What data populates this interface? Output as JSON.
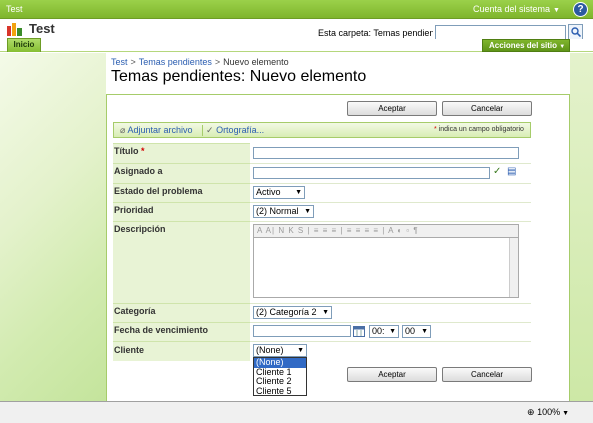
{
  "topbar": {
    "title": "Test",
    "account": "Cuenta del sistema",
    "help_icon": "?"
  },
  "header": {
    "site_title": "Test",
    "search_scope": "Esta carpeta: Temas pendienti",
    "search_value": "",
    "home_tab": "Inicio",
    "site_actions": "Acciones del sitio"
  },
  "breadcrumb": {
    "items": [
      "Test",
      "Temas pendientes",
      "Nuevo elemento"
    ],
    "separator": ">"
  },
  "page_title": "Temas pendientes: Nuevo elemento",
  "buttons": {
    "ok": "Aceptar",
    "cancel": "Cancelar"
  },
  "toolbar": {
    "attach": "Adjuntar archivo",
    "spelling": "Ortografía...",
    "required_marker": "*",
    "required_note": "indica un campo obligatorio"
  },
  "form": {
    "title_label": "Título",
    "title_required": "*",
    "assigned_label": "Asignado a",
    "status_label": "Estado del problema",
    "status_value": "Activo",
    "priority_label": "Prioridad",
    "priority_value": "(2) Normal",
    "description_label": "Descripción",
    "category_label": "Categoría",
    "category_value": "(2) Categoría 2",
    "due_label": "Fecha de vencimiento",
    "due_hour": "00:",
    "due_minute": "00",
    "client_label": "Cliente",
    "client_value": "(None)",
    "client_options": [
      "(None)",
      "Cliente 1",
      "Cliente 2",
      "Cliente 5"
    ]
  },
  "rte_toolbar": "A A| N K S | ≡ ≡ ≡ | ≡ ≡ ≡ ≡ | A ◐ ▫ ¶",
  "status_bar": {
    "zoom": "100%"
  },
  "colors": {
    "accent": "#7fb52c",
    "link": "#2a5db0",
    "required": "#d40000",
    "selection": "#316ac5"
  }
}
